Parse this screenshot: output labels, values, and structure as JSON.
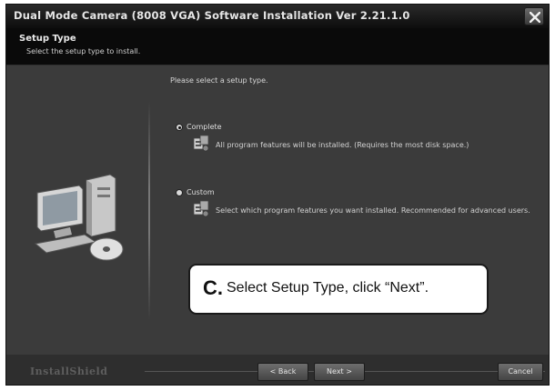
{
  "window": {
    "title": "Dual Mode Camera (8008 VGA) Software Installation Ver 2.21.1.0"
  },
  "header": {
    "title": "Setup Type",
    "subtitle": "Select the setup type to install."
  },
  "main": {
    "prompt": "Please select a setup type.",
    "options": [
      {
        "label": "Complete",
        "selected": true,
        "description": "All program features will be installed. (Requires the most disk space.)"
      },
      {
        "label": "Custom",
        "selected": false,
        "description": "Select which program features you want installed. Recommended for advanced users."
      }
    ]
  },
  "callout": {
    "letter": "C.",
    "text": "Select Setup Type, click “Next”."
  },
  "footer": {
    "brand": "InstallShield",
    "back_label": "< Back",
    "next_label": "Next >",
    "cancel_label": "Cancel"
  },
  "icons": {
    "close": "close-icon",
    "computer": "computer-icon",
    "setup": "setup-option-icon"
  }
}
